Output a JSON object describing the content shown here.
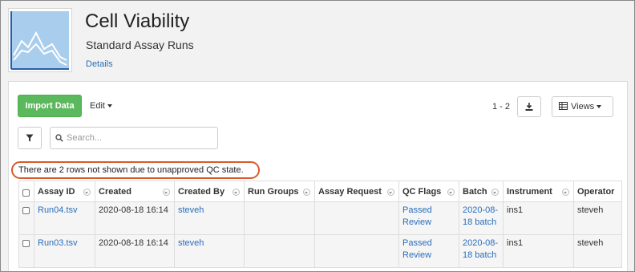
{
  "header": {
    "title": "Cell Viability",
    "subtitle": "Standard Assay Runs",
    "details_link": "Details",
    "logo_icon": "chart-line-icon"
  },
  "toolbar": {
    "import_label": "Import Data",
    "edit_label": "Edit",
    "paging": "1 - 2",
    "export_icon": "download-icon",
    "views_label": "Views",
    "filter_icon": "filter-icon",
    "search_placeholder": "Search..."
  },
  "qc_message": "There are 2 rows not shown due to unapproved QC state.",
  "grid": {
    "columns": [
      "Assay ID",
      "Created",
      "Created By",
      "Run Groups",
      "Assay Request",
      "QC Flags",
      "Batch",
      "Instrument",
      "Operator"
    ],
    "rows": [
      {
        "assay_id": "Run04.tsv",
        "created": "2020-08-18 16:14",
        "created_by": "steveh",
        "run_groups": "",
        "assay_request": "",
        "qc_flags": "Passed Review",
        "batch": "2020-08-18 batch",
        "instrument": "ins1",
        "operator": "steveh"
      },
      {
        "assay_id": "Run03.tsv",
        "created": "2020-08-18 16:14",
        "created_by": "steveh",
        "run_groups": "",
        "assay_request": "",
        "qc_flags": "Passed Review",
        "batch": "2020-08-18 batch",
        "instrument": "ins1",
        "operator": "steveh"
      }
    ]
  },
  "colors": {
    "accent_green": "#5cb85c",
    "link_blue": "#2a6ebb",
    "highlight_oval": "#d95a2b",
    "logo_blue": "#a9cdec"
  }
}
